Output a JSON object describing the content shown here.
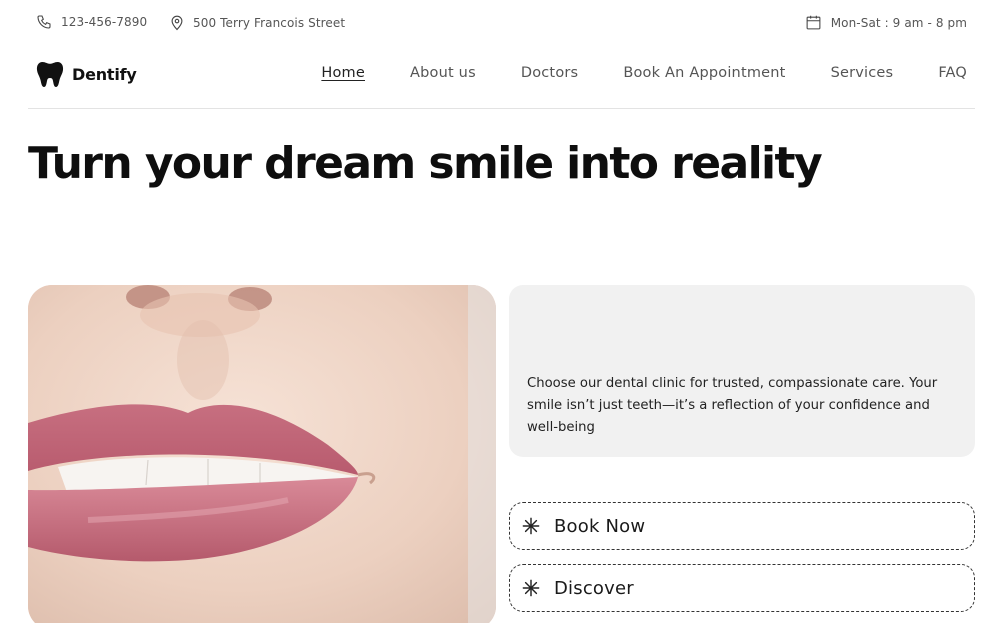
{
  "topbar": {
    "phone": "123-456-7890",
    "address": "500 Terry Francois Street",
    "hours": "Mon-Sat : 9 am - 8 pm"
  },
  "brand": {
    "name": "Dentify"
  },
  "nav": {
    "items": [
      {
        "label": "Home",
        "active": true
      },
      {
        "label": "About us"
      },
      {
        "label": "Doctors"
      },
      {
        "label": "Book An Appointment"
      },
      {
        "label": "Services"
      },
      {
        "label": "FAQ"
      }
    ]
  },
  "hero": {
    "title": "Turn your dream smile into reality",
    "description": "Choose our dental clinic for trusted, compassionate care. Your smile isn’t just teeth—it’s a reflection of your confidence and well-being"
  },
  "cta": {
    "book": "Book Now",
    "discover": "Discover"
  },
  "icons": {
    "phone": "phone-icon",
    "location": "location-pin-icon",
    "calendar": "calendar-icon",
    "logo": "tooth-icon",
    "cta": "asterisk-icon"
  }
}
